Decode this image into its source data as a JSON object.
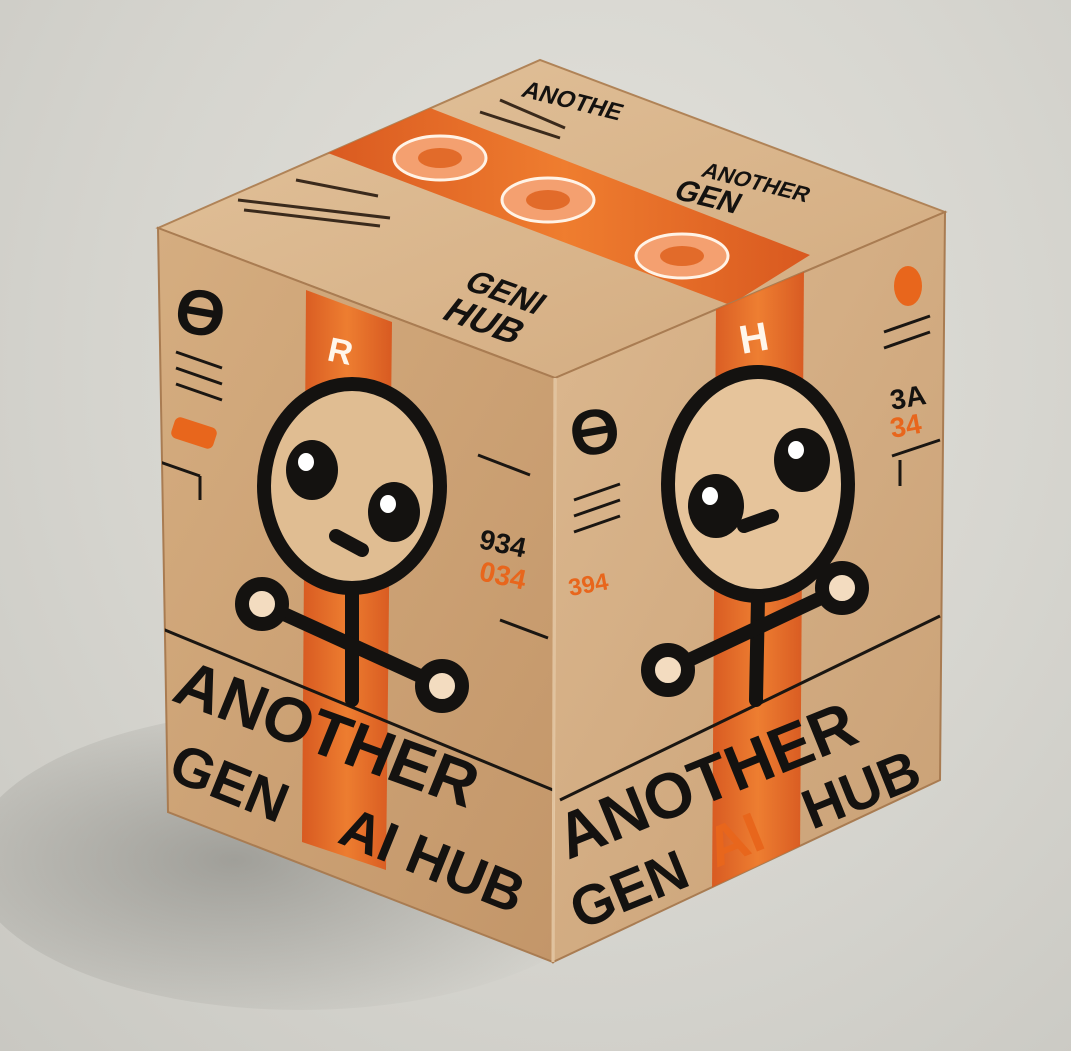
{
  "scene": {
    "subject": "cardboard-box",
    "colors": {
      "background": "#d8d7d1",
      "cardboard_light": "#dcb58a",
      "cardboard_mid": "#c99d70",
      "cardboard_dark": "#b68a5f",
      "tape": "#e8661c",
      "ink": "#141210",
      "shadow": "#a9a8a2"
    }
  },
  "box": {
    "top": {
      "brand_text": "ANOTHE",
      "logo_text_line1": "ANOTHER",
      "logo_text_line2": "GEN",
      "label_line1": "GENI",
      "label_line2": "HUB",
      "tape_circles": 3
    },
    "left_face": {
      "title_line1": "ANOTHER",
      "title_line2_a": "GEN",
      "title_line2_b": "AI HUB",
      "tape_letter": "R",
      "corner_glyph": "ϴ",
      "number_1": "934",
      "number_2": "034",
      "icon": "robot-mascot-icon"
    },
    "right_face": {
      "title_line1": "ANOTHER",
      "title_line2_a": "GEN",
      "title_line2_b": "AI",
      "title_line2_c": "HUB",
      "tape_letter": "H",
      "corner_glyph": "ϴ",
      "number_1": "3A",
      "number_2": "34",
      "number_3": "394",
      "icon": "robot-mascot-icon"
    }
  }
}
